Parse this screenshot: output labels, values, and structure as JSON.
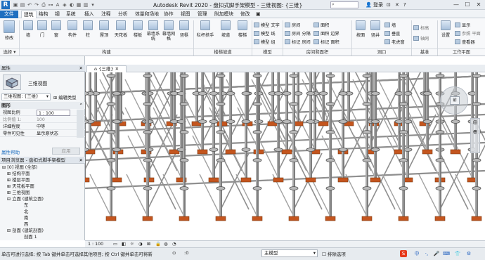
{
  "app": {
    "title": "Autodesk Revit 2020 - 盘扣式脚手架模型 - 三维视图: {三维}",
    "logo": "R",
    "user": "登录",
    "search_placeholder": "",
    "window_controls": [
      "—",
      "☐",
      "✕"
    ]
  },
  "menu": {
    "tabs": [
      "文件",
      "建筑",
      "结构",
      "钢",
      "系统",
      "插入",
      "注释",
      "分析",
      "体量和场地",
      "协作",
      "视图",
      "管理",
      "附加模块",
      "修改"
    ],
    "active_index": 1
  },
  "ribbon": {
    "big_buttons": [
      {
        "label": "修改",
        "icon": "modify-arrow-icon"
      },
      {
        "label": "墙",
        "icon": "wall-icon"
      },
      {
        "label": "门",
        "icon": "door-icon"
      },
      {
        "label": "窗",
        "icon": "window-icon"
      },
      {
        "label": "构件",
        "icon": "component-icon"
      },
      {
        "label": "柱",
        "icon": "column-icon"
      },
      {
        "label": "屋顶",
        "icon": "roof-icon"
      },
      {
        "label": "天花板",
        "icon": "ceiling-icon"
      },
      {
        "label": "楼板",
        "icon": "floor-icon"
      },
      {
        "label": "幕墙系统",
        "icon": "curtain-system-icon"
      },
      {
        "label": "幕墙网格",
        "icon": "curtain-grid-icon"
      },
      {
        "label": "竖梃",
        "icon": "mullion-icon"
      },
      {
        "label": "栏杆扶手",
        "icon": "railing-icon"
      },
      {
        "label": "坡道",
        "icon": "ramp-icon"
      },
      {
        "label": "楼梯",
        "icon": "stair-icon"
      },
      {
        "label": "按面",
        "icon": "by-face-icon"
      },
      {
        "label": "竖井",
        "icon": "shaft-icon"
      },
      {
        "label": "设置",
        "icon": "set-workplane-icon"
      }
    ],
    "small_buttons": [
      {
        "label": "模型 文字",
        "icon": "model-text-icon"
      },
      {
        "label": "模型 线",
        "icon": "model-line-icon"
      },
      {
        "label": "模型 组",
        "icon": "model-group-icon"
      },
      {
        "label": "房间",
        "icon": "room-icon"
      },
      {
        "label": "房间 分隔",
        "icon": "room-separator-icon"
      },
      {
        "label": "标记 房间",
        "icon": "tag-room-icon"
      },
      {
        "label": "面积",
        "icon": "area-icon"
      },
      {
        "label": "面积 边界",
        "icon": "area-boundary-icon"
      },
      {
        "label": "标记 面积",
        "icon": "tag-area-icon"
      },
      {
        "label": "墙",
        "icon": "wall-opening-icon"
      },
      {
        "label": "垂直",
        "icon": "vertical-opening-icon"
      },
      {
        "label": "老虎窗",
        "icon": "dormer-icon"
      },
      {
        "label": "标高",
        "icon": "level-icon"
      },
      {
        "label": "轴网",
        "icon": "grid-icon"
      },
      {
        "label": "显示",
        "icon": "show-workplane-icon"
      },
      {
        "label": "参照 平面",
        "icon": "ref-plane-icon"
      },
      {
        "label": "查看器",
        "icon": "viewer-icon"
      }
    ],
    "groups": [
      "选择",
      "构建",
      "楼梯坡道",
      "模型",
      "房间和面积",
      "洞口",
      "基准",
      "工作平面"
    ]
  },
  "properties": {
    "header": "属性",
    "type_name": "三维视图",
    "selector": "三维视图: {三维}",
    "edit_type": "编辑类型",
    "section": "图形",
    "rows": [
      {
        "k": "视图比例",
        "v": "1 : 100"
      },
      {
        "k": "比例值 1:",
        "v": "100"
      },
      {
        "k": "详细程度",
        "v": "中等"
      },
      {
        "k": "零件可见性",
        "v": "显示原状态"
      }
    ],
    "help_link": "属性帮助",
    "apply": "应用"
  },
  "browser": {
    "header": "项目浏览器 - 盘扣式脚手架模型",
    "items": [
      "⊟ [0] 视图 (全部)",
      "⊞ 结构平面",
      "⊞ 楼层平面",
      "⊞ 天花板平面",
      "⊞ 三维视图",
      "⊟ 立面 (建筑立面)",
      "东",
      "北",
      "南",
      "西",
      "⊟ 剖面 (建筑剖面)",
      "剖面 1"
    ]
  },
  "view": {
    "tab": "{三维}",
    "scale": "1 : 100",
    "steer": "前"
  },
  "status": {
    "message": "单击可进行选择; 按 Tab 键并单击可选择其他项目; 按 Ctrl 键并单击可将新",
    "coord": ":0",
    "model": "主模型",
    "filter": "排除选项",
    "ime": [
      "S",
      "中",
      "·,",
      "🎤",
      "⌨",
      "👕",
      "⚙"
    ]
  },
  "colors": {
    "accent": "#1f6fc0",
    "pipe": "#8f8f8f",
    "baseplate": "#c4551e"
  }
}
